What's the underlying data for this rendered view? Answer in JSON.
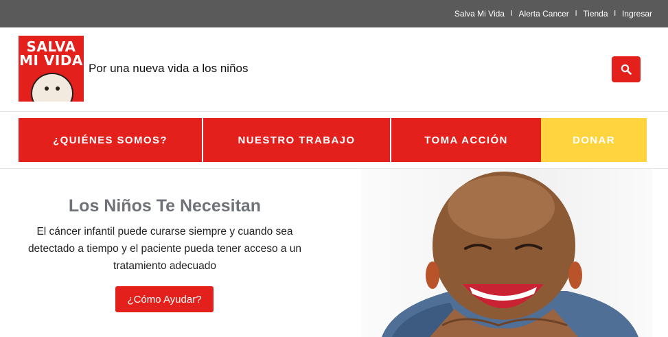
{
  "topbar": {
    "links": [
      "Salva Mi Vida",
      "Alerta Cancer",
      "Tienda",
      "Ingresar"
    ],
    "separator": "l"
  },
  "header": {
    "logo_lines": [
      "SALVA",
      "MI VIDA"
    ],
    "tagline": "Por una nueva vida a los niños",
    "search_icon": "search-icon"
  },
  "nav": {
    "items": [
      "¿QUIÉNES SOMOS?",
      "NUESTRO TRABAJO",
      "TOMA ACCIÓN",
      "DONAR"
    ]
  },
  "hero": {
    "title": "Los Niños Te Necesitan",
    "description": "El cáncer infantil puede curarse siempre y cuando sea detectado a tiempo y el paciente pueda tener acceso a un tratamiento adecuado",
    "button": "¿Cómo Ayudar?"
  },
  "colors": {
    "brand_red": "#e3201b",
    "donate_yellow": "#ffd43f",
    "topbar": "#5a5a5a",
    "title_gray": "#6f7378"
  }
}
